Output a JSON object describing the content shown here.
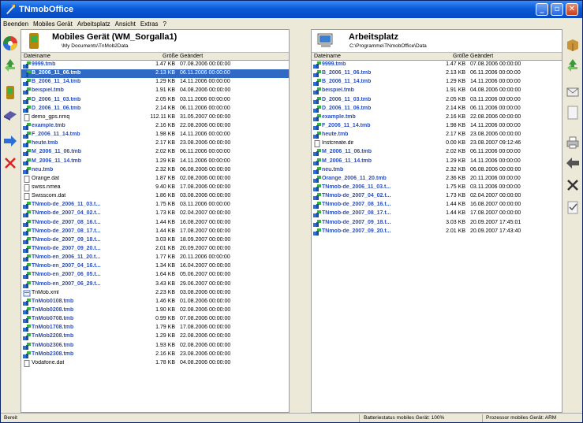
{
  "window": {
    "title": "TNmobOffice"
  },
  "menu": [
    "Beenden",
    "Mobiles Gerät",
    "Arbeitsplatz",
    "Ansicht",
    "Extras",
    "?"
  ],
  "left_panel": {
    "title": "Mobiles Gerät (WM_Sorgalla1)",
    "path": "\\My Documents\\TnMob2Data",
    "columns": {
      "name": "Dateiname",
      "size": "Größe",
      "changed": "Geändert"
    },
    "files": [
      {
        "name": "9999.tmb",
        "size": "1.47 KB",
        "date": "07.08.2006 00:00:00",
        "type": "tmb"
      },
      {
        "name": "B_2006_11_06.tmb",
        "size": "2.13 KB",
        "date": "06.11.2006 00:00:00",
        "type": "tmb",
        "selected": true
      },
      {
        "name": "B_2006_11_14.tmb",
        "size": "1.29 KB",
        "date": "14.11.2006 00:00:00",
        "type": "tmb"
      },
      {
        "name": "beispiel.tmb",
        "size": "1.91 KB",
        "date": "04.08.2006 00:00:00",
        "type": "tmb"
      },
      {
        "name": "D_2006_11_03.tmb",
        "size": "2.05 KB",
        "date": "03.11.2006 00:00:00",
        "type": "tmb"
      },
      {
        "name": "D_2006_11_06.tmb",
        "size": "2.14 KB",
        "date": "06.11.2006 00:00:00",
        "type": "tmb"
      },
      {
        "name": "demo_gps.nmq",
        "size": "112.11 KB",
        "date": "31.05.2007 00:00:00",
        "type": "doc"
      },
      {
        "name": "example.tmb",
        "size": "2.16 KB",
        "date": "22.08.2006 00:00:00",
        "type": "tmb"
      },
      {
        "name": "F_2006_11_14.tmb",
        "size": "1.98 KB",
        "date": "14.11.2006 00:00:00",
        "type": "tmb"
      },
      {
        "name": "heute.tmb",
        "size": "2.17 KB",
        "date": "23.08.2006 00:00:00",
        "type": "tmb"
      },
      {
        "name": "M_2006_11_06.tmb",
        "size": "2.02 KB",
        "date": "06.11.2006 00:00:00",
        "type": "tmb"
      },
      {
        "name": "M_2006_11_14.tmb",
        "size": "1.29 KB",
        "date": "14.11.2006 00:00:00",
        "type": "tmb"
      },
      {
        "name": "neu.tmb",
        "size": "2.32 KB",
        "date": "06.08.2006 00:00:00",
        "type": "tmb"
      },
      {
        "name": "Orange.dat",
        "size": "1.87 KB",
        "date": "02.08.2006 00:00:00",
        "type": "doc"
      },
      {
        "name": "swiss.nmea",
        "size": "9.40 KB",
        "date": "17.08.2006 00:00:00",
        "type": "doc"
      },
      {
        "name": "Swisscom.dat",
        "size": "1.86 KB",
        "date": "03.08.2006 00:00:00",
        "type": "doc"
      },
      {
        "name": "TNmob-de_2006_11_03.t...",
        "size": "1.75 KB",
        "date": "03.11.2006 00:00:00",
        "type": "tmb"
      },
      {
        "name": "TNmob-de_2007_04_02.t...",
        "size": "1.73 KB",
        "date": "02.04.2007 00:00:00",
        "type": "tmb"
      },
      {
        "name": "TNmob-de_2007_08_16.t...",
        "size": "1.44 KB",
        "date": "16.08.2007 00:00:00",
        "type": "tmb"
      },
      {
        "name": "TNmob-de_2007_08_17.t...",
        "size": "1.44 KB",
        "date": "17.08.2007 00:00:00",
        "type": "tmb"
      },
      {
        "name": "TNmob-de_2007_09_18.t...",
        "size": "3.03 KB",
        "date": "18.09.2007 00:00:00",
        "type": "tmb"
      },
      {
        "name": "TNmob-de_2007_09_20.t...",
        "size": "2.01 KB",
        "date": "20.09.2007 00:00:00",
        "type": "tmb"
      },
      {
        "name": "TNmob-en_2006_11_20.t...",
        "size": "1.77 KB",
        "date": "20.11.2006 00:00:00",
        "type": "tmb"
      },
      {
        "name": "TNmob-en_2007_04_16.t...",
        "size": "1.34 KB",
        "date": "16.04.2007 00:00:00",
        "type": "tmb"
      },
      {
        "name": "TNmob-en_2007_06_05.t...",
        "size": "1.64 KB",
        "date": "05.06.2007 00:00:00",
        "type": "tmb"
      },
      {
        "name": "TNmob-en_2007_06_29.t...",
        "size": "3.43 KB",
        "date": "29.06.2007 00:00:00",
        "type": "tmb"
      },
      {
        "name": "TnMob.xml",
        "size": "2.23 KB",
        "date": "03.08.2006 00:00:00",
        "type": "xml"
      },
      {
        "name": "TnMob0108.tmb",
        "size": "1.46 KB",
        "date": "01.08.2006 00:00:00",
        "type": "tmb"
      },
      {
        "name": "TnMob0208.tmb",
        "size": "1.90 KB",
        "date": "02.08.2006 00:00:00",
        "type": "tmb"
      },
      {
        "name": "TnMob0708.tmb",
        "size": "0.99 KB",
        "date": "07.08.2006 00:00:00",
        "type": "tmb"
      },
      {
        "name": "TnMob1708.tmb",
        "size": "1.79 KB",
        "date": "17.08.2006 00:00:00",
        "type": "tmb"
      },
      {
        "name": "TnMob2208.tmb",
        "size": "1.29 KB",
        "date": "22.08.2006 00:00:00",
        "type": "tmb"
      },
      {
        "name": "TnMob2306.tmb",
        "size": "1.93 KB",
        "date": "02.08.2006 00:00:00",
        "type": "tmb"
      },
      {
        "name": "TnMob2308.tmb",
        "size": "2.16 KB",
        "date": "23.08.2006 00:00:00",
        "type": "tmb"
      },
      {
        "name": "Vodafone.dat",
        "size": "1.78 KB",
        "date": "04.08.2006 00:00:00",
        "type": "doc"
      }
    ]
  },
  "right_panel": {
    "title": "Arbeitsplatz",
    "path": "C:\\Programme\\TNmobOffice\\Data",
    "columns": {
      "name": "Dateiname",
      "size": "Größe",
      "changed": "Geändert"
    },
    "files": [
      {
        "name": "9999.tmb",
        "size": "1.47 KB",
        "date": "07.08.2006 00:00:00",
        "type": "tmb"
      },
      {
        "name": "B_2006_11_06.tmb",
        "size": "2.13 KB",
        "date": "06.11.2006 00:00:00",
        "type": "tmb"
      },
      {
        "name": "B_2006_11_14.tmb",
        "size": "1.29 KB",
        "date": "14.11.2006 00:00:00",
        "type": "tmb"
      },
      {
        "name": "beispiel.tmb",
        "size": "1.91 KB",
        "date": "04.08.2006 00:00:00",
        "type": "tmb"
      },
      {
        "name": "D_2006_11_03.tmb",
        "size": "2.05 KB",
        "date": "03.11.2006 00:00:00",
        "type": "tmb"
      },
      {
        "name": "D_2006_11_06.tmb",
        "size": "2.14 KB",
        "date": "06.11.2006 00:00:00",
        "type": "tmb"
      },
      {
        "name": "example.tmb",
        "size": "2.16 KB",
        "date": "22.08.2006 00:00:00",
        "type": "tmb"
      },
      {
        "name": "F_2006_11_14.tmb",
        "size": "1.98 KB",
        "date": "14.11.2006 00:00:00",
        "type": "tmb"
      },
      {
        "name": "heute.tmb",
        "size": "2.17 KB",
        "date": "23.08.2006 00:00:00",
        "type": "tmb"
      },
      {
        "name": "Instcreate.dir",
        "size": "0.00 KB",
        "date": "23.08.2007 09:12:46",
        "type": "doc"
      },
      {
        "name": "M_2006_11_06.tmb",
        "size": "2.02 KB",
        "date": "06.11.2006 00:00:00",
        "type": "tmb"
      },
      {
        "name": "M_2006_11_14.tmb",
        "size": "1.29 KB",
        "date": "14.11.2006 00:00:00",
        "type": "tmb"
      },
      {
        "name": "neu.tmb",
        "size": "2.32 KB",
        "date": "06.08.2006 00:00:00",
        "type": "tmb"
      },
      {
        "name": "Orange_2006_11_20.tmb",
        "size": "2.36 KB",
        "date": "20.11.2006 00:00:00",
        "type": "tmb"
      },
      {
        "name": "TNmob-de_2006_11_03.t...",
        "size": "1.75 KB",
        "date": "03.11.2006 00:00:00",
        "type": "tmb"
      },
      {
        "name": "TNmob-de_2007_04_02.t...",
        "size": "1.73 KB",
        "date": "02.04.2007 00:00:00",
        "type": "tmb"
      },
      {
        "name": "TNmob-de_2007_08_16.t...",
        "size": "1.44 KB",
        "date": "16.08.2007 00:00:00",
        "type": "tmb"
      },
      {
        "name": "TNmob-de_2007_08_17.t...",
        "size": "1.44 KB",
        "date": "17.08.2007 00:00:00",
        "type": "tmb"
      },
      {
        "name": "TNmob-de_2007_09_18.t...",
        "size": "3.03 KB",
        "date": "20.09.2007 17:45:01",
        "type": "tmb"
      },
      {
        "name": "TNmob-de_2007_09_20.t...",
        "size": "2.01 KB",
        "date": "20.09.2007 17:43:40",
        "type": "tmb"
      }
    ]
  },
  "status": {
    "left": "Bereit",
    "battery": "Batteriestatus mobiles Gerät: 100%",
    "processor": "Prozessor mobiles Gerät: ARM"
  },
  "colors": {
    "titlebar": "#0a5ad8",
    "selection": "#316ac5",
    "file_link": "#2b4fbf"
  }
}
